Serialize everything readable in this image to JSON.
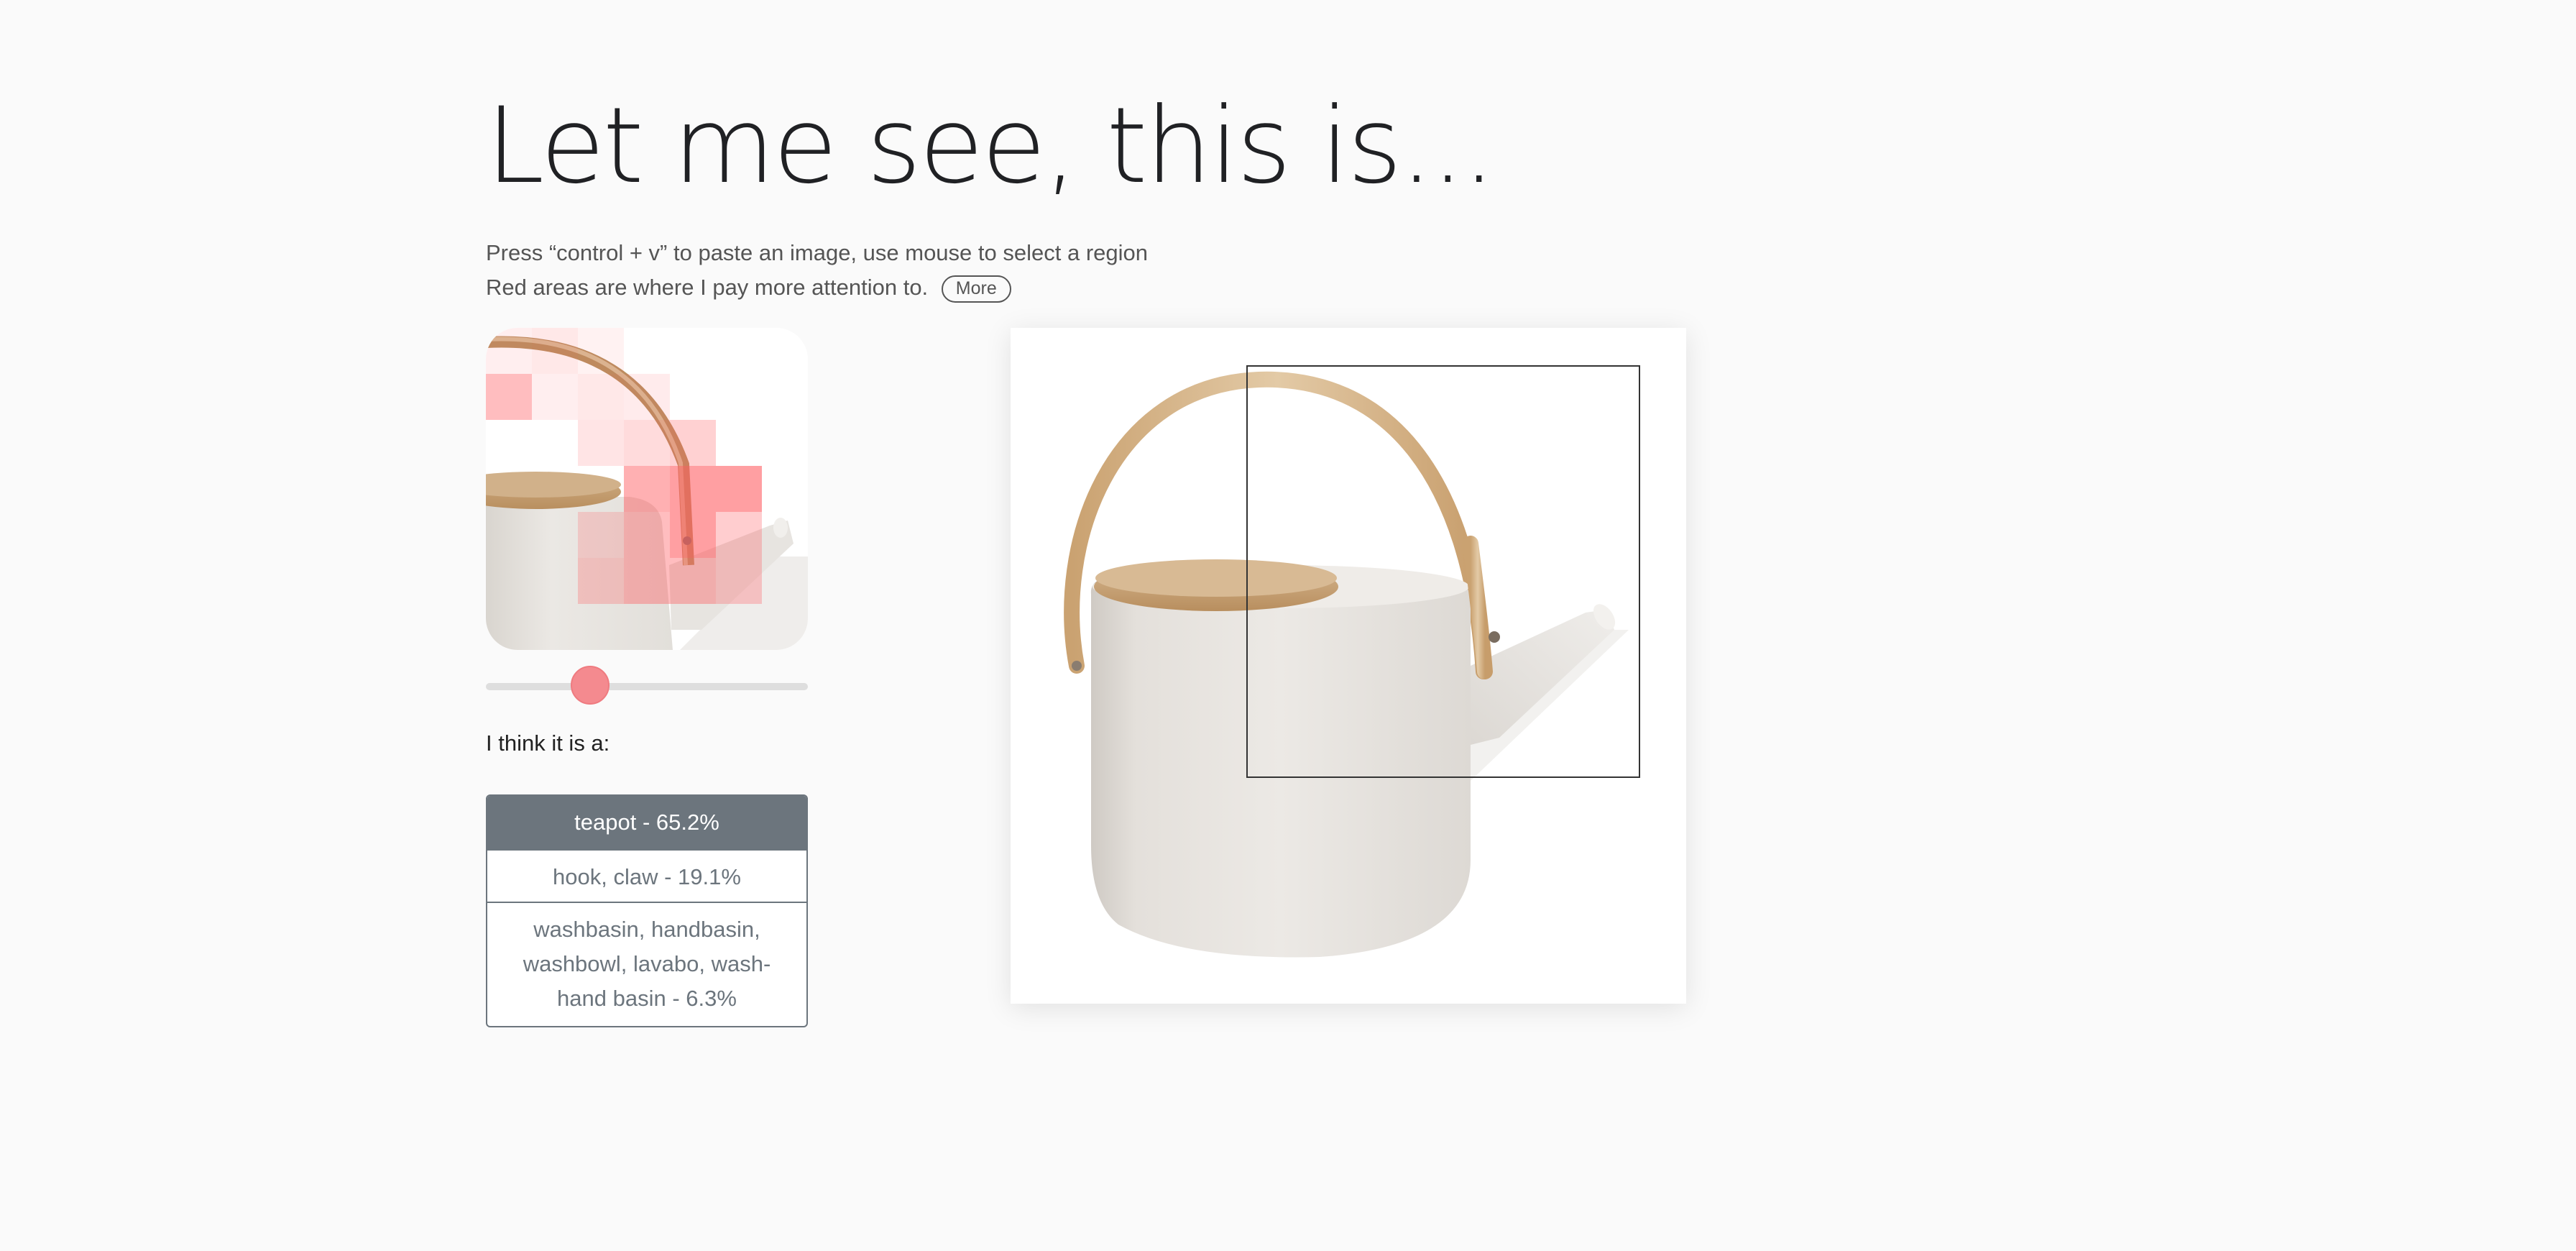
{
  "header": {
    "title": "Let me see, this is...",
    "instruction_line1": "Press “control + v” to paste an image, use mouse to select a region",
    "instruction_line2": "Red areas are where I pay more attention to.",
    "more_label": "More"
  },
  "attention": {
    "slider_value": 0.3
  },
  "results": {
    "heading": "I think it is a:",
    "predictions": [
      {
        "label": "teapot - 65.2%"
      },
      {
        "label": "hook, claw - 19.1%"
      },
      {
        "label": "washbasin, handbasin, washbowl, lavabo, wash-hand basin - 6.3%"
      }
    ]
  },
  "colors": {
    "accent": "#f48a8f",
    "prediction_active_bg": "#6c757d",
    "background": "#fafafa"
  }
}
